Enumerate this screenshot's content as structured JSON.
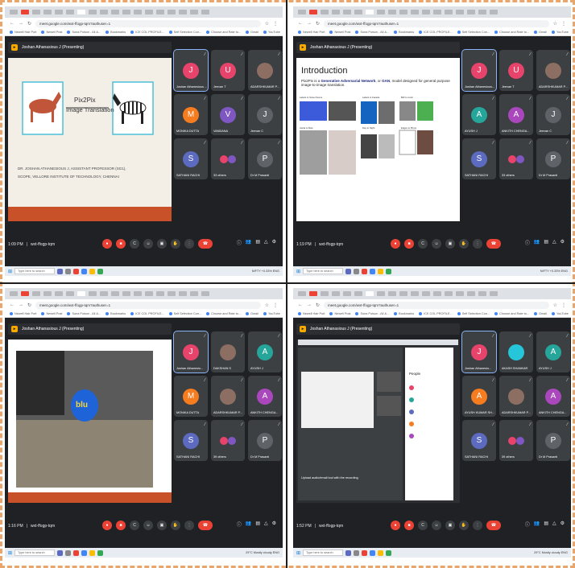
{
  "panels": [
    {
      "meeting_url": "meet.google.com/wxt-ffogp-tqm?authuser=1",
      "presenter_banner": "Joshan Athanasious J (Presenting)",
      "time": "1:09 PM",
      "meeting_code": "wxt-ffogp-tqm",
      "slide": {
        "title": "Pix2Pix",
        "subtitle": "Image Translation",
        "caption1": "DR. JOSHAN ATHANESIOUS J, ASSISTANT PROFESSOR (SG1),",
        "caption2": "SCOPE, VELLORE INSTITUTE OF TECHNOLOGY, CHENNAI"
      },
      "tiles": [
        {
          "name": "Joshan Athanesious ...",
          "initial": "J",
          "color": "#e8436b",
          "highlight": true
        },
        {
          "name": "Jeevan T",
          "initial": "U",
          "color": "#e8436b"
        },
        {
          "name": "ADARSHKUMAR P...",
          "initial": "",
          "color": "photo"
        },
        {
          "name": "MONIKA DUTTA",
          "initial": "M",
          "color": "#f57c1f"
        },
        {
          "name": "VANDANA",
          "initial": "V",
          "color": "#7e57c2"
        },
        {
          "name": "Jeevan C",
          "initial": "J",
          "color": "#5f6368"
        },
        {
          "name": "SATHANI RACHI",
          "initial": "S",
          "color": "#5c6bc0"
        },
        {
          "name": "33 others",
          "initial": "",
          "color": "others"
        },
        {
          "name": "Dr M Prasanti",
          "initial": "P",
          "color": "#5f6368"
        }
      ],
      "tray": "NIFTY +0.33%  ENG"
    },
    {
      "meeting_url": "meet.google.com/wxt-ffogp-tqm?authuser=1",
      "presenter_banner": "Joshan Athanasious J (Presenting)",
      "time": "1:19 PM",
      "meeting_code": "wxt-ffogp-tqm",
      "slide": {
        "title": "Introduction",
        "body_prefix": "Pix2Pix is a ",
        "body_bold": "Generative Adversarial Network",
        "body_mid": ", or ",
        "body_bold2": "GAN",
        "body_suffix": ", model designed for general purpose image-to-image translation.",
        "labels": [
          "Labels to Street Scene",
          "Labels to Facade",
          "BW to Color",
          "Aerial to Map",
          "Day to Night",
          "Edges to Photo"
        ]
      },
      "tiles": [
        {
          "name": "Joshan Athanesious...",
          "initial": "J",
          "color": "#e8436b",
          "highlight": true
        },
        {
          "name": "Jeevan T",
          "initial": "U",
          "color": "#e8436b"
        },
        {
          "name": "ADARSHKUMAR P...",
          "initial": "",
          "color": "photo"
        },
        {
          "name": "AYUSH J",
          "initial": "A",
          "color": "#26a69a"
        },
        {
          "name": "ANKITH CHENGA...",
          "initial": "A",
          "color": "#ab47bc"
        },
        {
          "name": "Jeevan C",
          "initial": "J",
          "color": "#5f6368"
        },
        {
          "name": "SATHANI RACHI",
          "initial": "S",
          "color": "#5c6bc0"
        },
        {
          "name": "33 others",
          "initial": "",
          "color": "others"
        },
        {
          "name": "Dr M Prasanti",
          "initial": "P",
          "color": "#5f6368"
        }
      ],
      "tray": "NIFTY +0.33%  ENG"
    },
    {
      "meeting_url": "meet.google.com/wxt-ffogp-tqm?authuser=1",
      "presenter_banner": "Joshan Athanasious J (Presenting)",
      "time": "1:16 PM",
      "meeting_code": "wxt-ffogp-tqm",
      "slide": {
        "logo_text": "blu"
      },
      "tiles": [
        {
          "name": "Joshan Athanesio...",
          "initial": "J",
          "color": "#e8436b",
          "highlight": true
        },
        {
          "name": "DAKSHAN S",
          "initial": "",
          "color": "photo"
        },
        {
          "name": "AYUSH J",
          "initial": "A",
          "color": "#26a69a"
        },
        {
          "name": "MONIKA DUTTA",
          "initial": "M",
          "color": "#f57c1f"
        },
        {
          "name": "ADARSHKUMAR P...",
          "initial": "",
          "color": "photo"
        },
        {
          "name": "ANKITH CHENGA...",
          "initial": "A",
          "color": "#ab47bc"
        },
        {
          "name": "SATHANI RACHI",
          "initial": "S",
          "color": "#5c6bc0"
        },
        {
          "name": "39 others",
          "initial": "",
          "color": "others"
        },
        {
          "name": "Dr M Prasanti",
          "initial": "P",
          "color": "#5f6368"
        }
      ],
      "tray": "29°C  Mostly cloudy  ENG"
    },
    {
      "meeting_url": "meet.google.com/wxt-ffogp-tqm?authuser=1",
      "presenter_banner": "Joshan Athanasious J (Presenting)",
      "time": "1:52 PM",
      "meeting_code": "wxt-ffogp-tqm",
      "slide": {
        "caption": "Upload audio/email tool with the recording",
        "people_header": "People"
      },
      "tiles": [
        {
          "name": "Joshan Athanesio...",
          "initial": "J",
          "color": "#e8436b",
          "highlight": true
        },
        {
          "name": "AKASH SHANKAR",
          "initial": "",
          "color": "#26c6da"
        },
        {
          "name": "AYUSH J",
          "initial": "A",
          "color": "#26a69a"
        },
        {
          "name": "AYUSH KUMAR SH...",
          "initial": "A",
          "color": "#f57c1f"
        },
        {
          "name": "ADARSHKUMAR P...",
          "initial": "",
          "color": "photo"
        },
        {
          "name": "ANKITH CHENGA...",
          "initial": "A",
          "color": "#ab47bc"
        },
        {
          "name": "SATHANI RACHI",
          "initial": "S",
          "color": "#5c6bc0"
        },
        {
          "name": "39 others",
          "initial": "",
          "color": "others"
        },
        {
          "name": "Dr M Prasanti",
          "initial": "P",
          "color": "#5f6368"
        }
      ],
      "tray": "29°C  Mostly cloudy  ENG"
    }
  ],
  "common": {
    "search_placeholder": "Type here to search",
    "taskbar_start": "⊞",
    "bookmarks": [
      "Newell Hair Port",
      "Newell Post",
      "Sona Poison - All &...",
      "Bookmarks",
      "ICE COL PROFILE...",
      "Self Selection Con...",
      "Choose and Rate to...",
      "Gmail",
      "YouTube",
      "Maps",
      "Self Assembled"
    ]
  }
}
